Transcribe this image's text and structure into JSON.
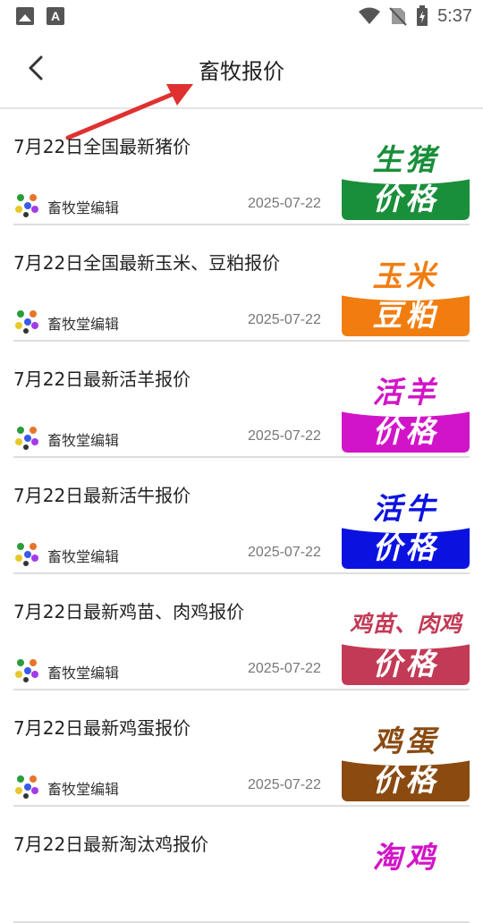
{
  "status": {
    "time": "5:37"
  },
  "header": {
    "title": "畜牧报价"
  },
  "colors": {
    "green": "#1a8f3a",
    "orange": "#f17d10",
    "magenta": "#d214c8",
    "blue": "#0b12e0",
    "crimson": "#c23a55",
    "brown": "#8a4a10"
  },
  "items": [
    {
      "title": "7月22日全国最新猪价",
      "author": "畜牧堂编辑",
      "date": "2025-07-22",
      "thumb_top": "生猪",
      "thumb_bottom": "价格"
    },
    {
      "title": "7月22日全国最新玉米、豆粕报价",
      "author": "畜牧堂编辑",
      "date": "2025-07-22",
      "thumb_top": "玉米",
      "thumb_bottom": "豆粕"
    },
    {
      "title": "7月22日最新活羊报价",
      "author": "畜牧堂编辑",
      "date": "2025-07-22",
      "thumb_top": "活羊",
      "thumb_bottom": "价格"
    },
    {
      "title": "7月22日最新活牛报价",
      "author": "畜牧堂编辑",
      "date": "2025-07-22",
      "thumb_top": "活牛",
      "thumb_bottom": "价格"
    },
    {
      "title": "7月22日最新鸡苗、肉鸡报价",
      "author": "畜牧堂编辑",
      "date": "2025-07-22",
      "thumb_top": "鸡苗、肉鸡",
      "thumb_bottom": "价格"
    },
    {
      "title": "7月22日最新鸡蛋报价",
      "author": "畜牧堂编辑",
      "date": "2025-07-22",
      "thumb_top": "鸡蛋",
      "thumb_bottom": "价格"
    },
    {
      "title": "7月22日最新淘汰鸡报价",
      "author": "",
      "date": "",
      "thumb_top": "淘鸡",
      "thumb_bottom": ""
    }
  ]
}
